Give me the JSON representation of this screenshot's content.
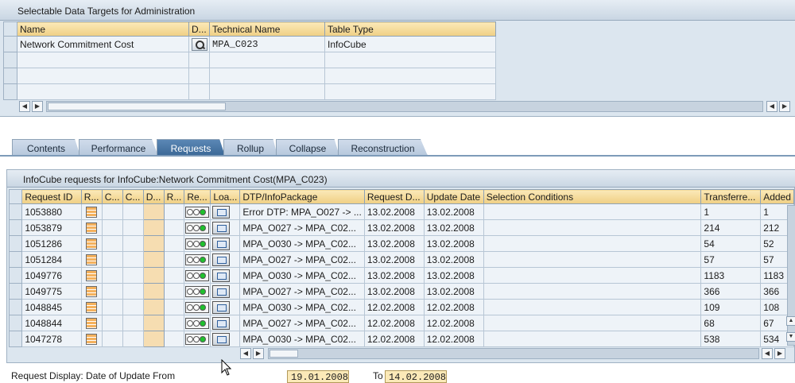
{
  "targets": {
    "title": "Selectable Data Targets for Administration",
    "columns": [
      "Name",
      "D...",
      "Technical Name",
      "Table Type"
    ],
    "rows": [
      {
        "name": "Network Commitment Cost",
        "technical": "MPA_C023",
        "type": "InfoCube"
      }
    ]
  },
  "tabs": [
    "Contents",
    "Performance",
    "Requests",
    "Rollup",
    "Collapse",
    "Reconstruction"
  ],
  "active_tab": "Requests",
  "requests": {
    "title": "InfoCube requests for InfoCube:Network Commitment Cost(MPA_C023)",
    "columns": [
      "Request ID",
      "R...",
      "C...",
      "C...",
      "D...",
      "R...",
      "Re...",
      "Loa...",
      "DTP/InfoPackage",
      "Request D...",
      "Update Date",
      "Selection Conditions",
      "Transferre...",
      "Added"
    ],
    "rows": [
      {
        "id": "1053880",
        "dtp": "Error DTP: MPA_O027 -> ...",
        "req_date": "13.02.2008",
        "upd_date": "13.02.2008",
        "transferred": "1",
        "added": "1"
      },
      {
        "id": "1053879",
        "dtp": "MPA_O027 -> MPA_C02...",
        "req_date": "13.02.2008",
        "upd_date": "13.02.2008",
        "transferred": "214",
        "added": "212"
      },
      {
        "id": "1051286",
        "dtp": "MPA_O030 -> MPA_C02...",
        "req_date": "13.02.2008",
        "upd_date": "13.02.2008",
        "transferred": "54",
        "added": "52"
      },
      {
        "id": "1051284",
        "dtp": "MPA_O027 -> MPA_C02...",
        "req_date": "13.02.2008",
        "upd_date": "13.02.2008",
        "transferred": "57",
        "added": "57"
      },
      {
        "id": "1049776",
        "dtp": "MPA_O030 -> MPA_C02...",
        "req_date": "13.02.2008",
        "upd_date": "13.02.2008",
        "transferred": "1183",
        "added": "1183"
      },
      {
        "id": "1049775",
        "dtp": "MPA_O027 -> MPA_C02...",
        "req_date": "13.02.2008",
        "upd_date": "13.02.2008",
        "transferred": "366",
        "added": "366"
      },
      {
        "id": "1048845",
        "dtp": "MPA_O030 -> MPA_C02...",
        "req_date": "12.02.2008",
        "upd_date": "12.02.2008",
        "transferred": "109",
        "added": "108"
      },
      {
        "id": "1048844",
        "dtp": "MPA_O027 -> MPA_C02...",
        "req_date": "12.02.2008",
        "upd_date": "12.02.2008",
        "transferred": "68",
        "added": "67"
      },
      {
        "id": "1047278",
        "dtp": "MPA_O030 -> MPA_C02...",
        "req_date": "12.02.2008",
        "upd_date": "12.02.2008",
        "transferred": "538",
        "added": "534"
      }
    ]
  },
  "footer": {
    "label": "Request Display: Date of Update From",
    "from": "19.01.2008",
    "to_label": "To",
    "to": "14.02.2008"
  },
  "icons": {
    "search": "magnifier-icon",
    "status_grid": "status-grid-icon",
    "lights": "traffic-light-icon",
    "load": "monitor-icon",
    "scroll_left": "◀",
    "scroll_right": "▶",
    "scroll_up": "▲",
    "scroll_down": "▼"
  },
  "colors": {
    "header_bg": "#efcf84",
    "panel_bg": "#dce6ef",
    "active_tab": "#3b6896",
    "green_light": "#1fc12d"
  }
}
